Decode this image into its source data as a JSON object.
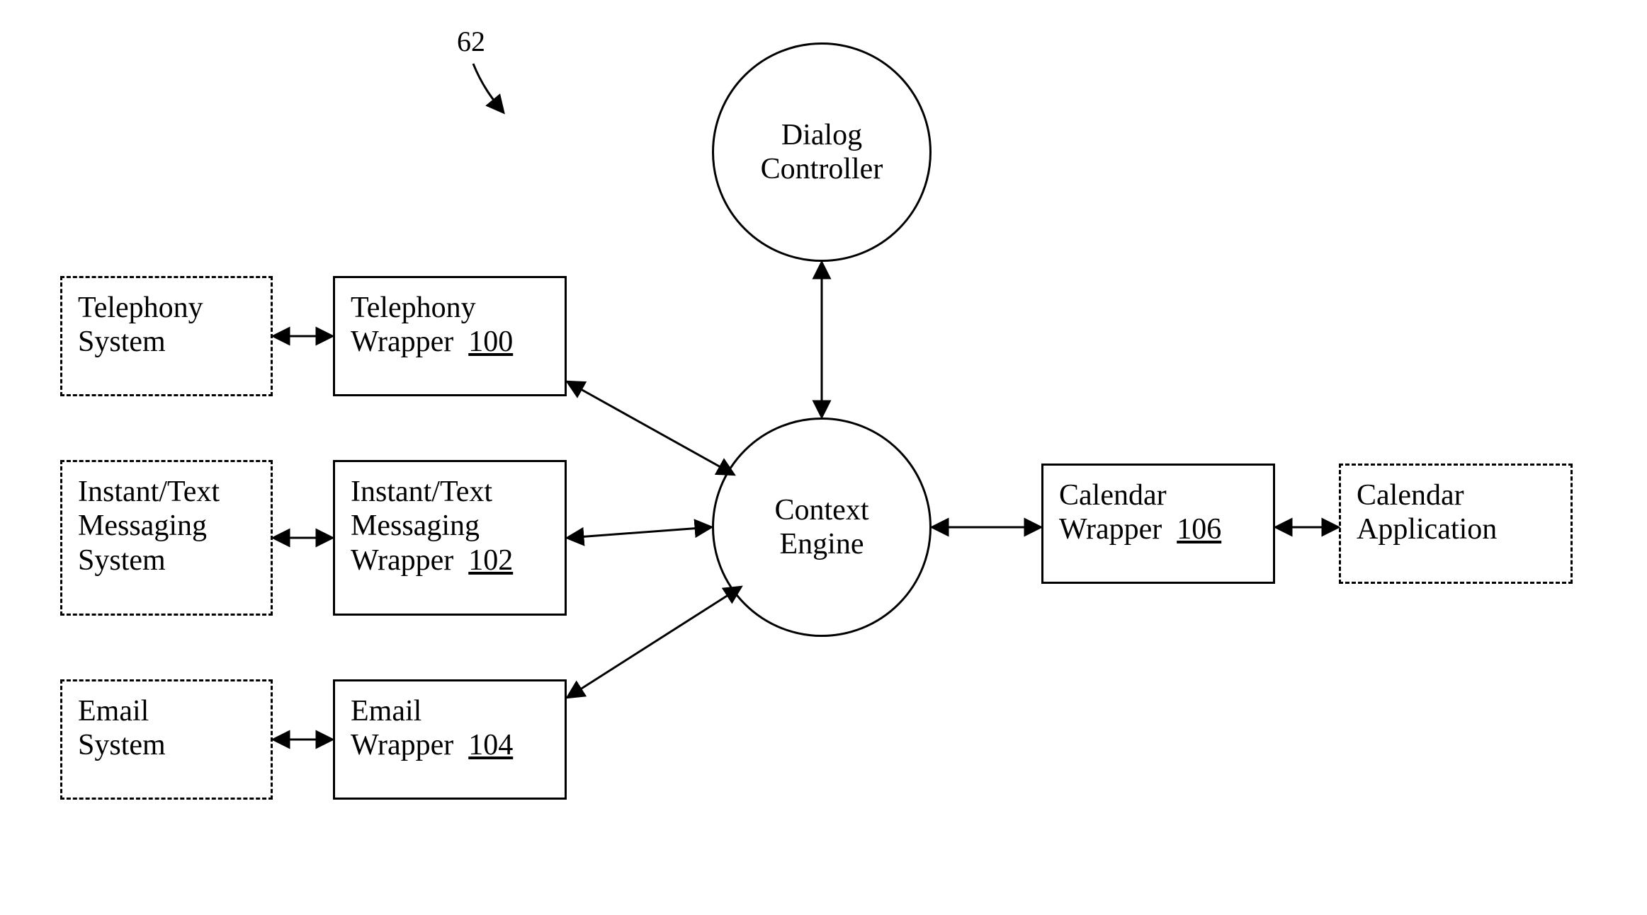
{
  "figure": {
    "label": "62"
  },
  "nodes": {
    "dialogController": "Dialog\nController",
    "contextEngine": "Context\nEngine",
    "telephonySystem": "Telephony\nSystem",
    "telephonyWrapper": {
      "text": "Telephony\nWrapper",
      "ref": "100"
    },
    "messagingSystem": "Instant/Text\nMessaging\nSystem",
    "messagingWrapper": {
      "text": "Instant/Text\nMessaging\nWrapper",
      "ref": "102"
    },
    "emailSystem": "Email\nSystem",
    "emailWrapper": {
      "text": "Email\nWrapper",
      "ref": "104"
    },
    "calendarWrapper": {
      "text": "Calendar\nWrapper",
      "ref": "106"
    },
    "calendarApp": "Calendar\nApplication"
  }
}
